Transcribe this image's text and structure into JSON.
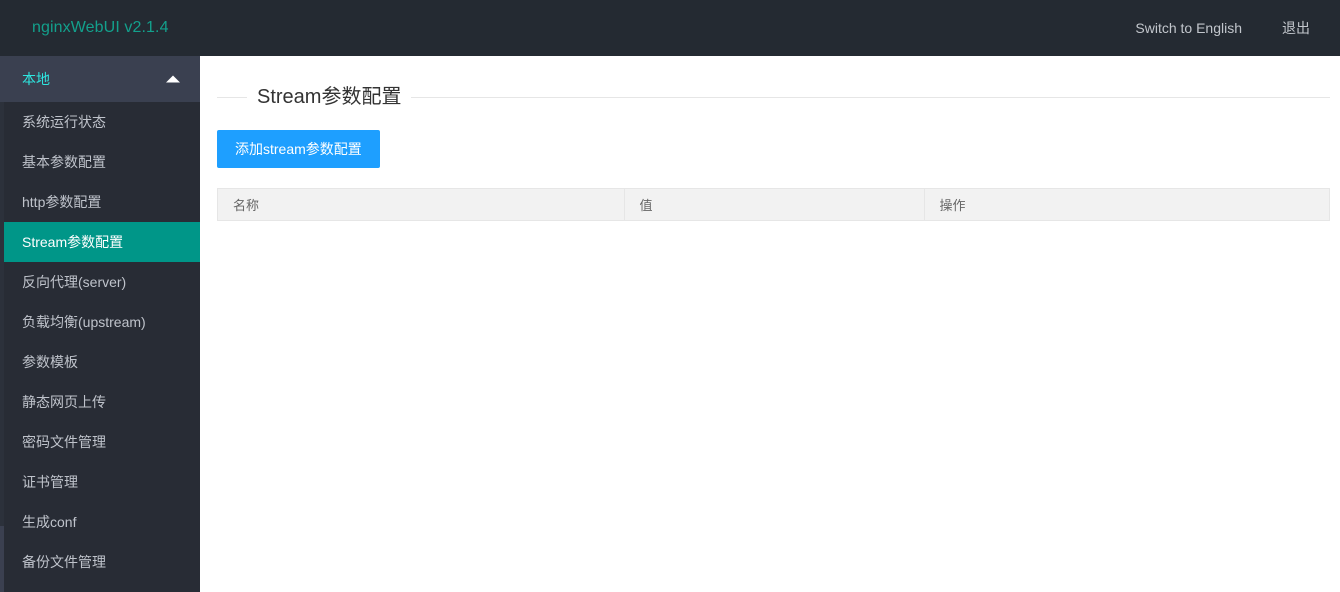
{
  "header": {
    "logo": "nginxWebUI v2.1.4",
    "switch_language": "Switch to English",
    "logout": "退出",
    "bg_color": "#242A32",
    "logo_color": "#13A08C"
  },
  "sidebar": {
    "group": {
      "label": "本地",
      "expanded": true,
      "arrow_icon": "chevron-up-icon",
      "label_color": "#2EE6E0",
      "bg_color": "#3A4050"
    },
    "active_color": "#009688",
    "bg_color": "#282C35",
    "items": [
      {
        "label": "系统运行状态",
        "active": false
      },
      {
        "label": "基本参数配置",
        "active": false
      },
      {
        "label": "http参数配置",
        "active": false
      },
      {
        "label": "Stream参数配置",
        "active": true
      },
      {
        "label": "反向代理(server)",
        "active": false
      },
      {
        "label": "负载均衡(upstream)",
        "active": false
      },
      {
        "label": "参数模板",
        "active": false
      },
      {
        "label": "静态网页上传",
        "active": false
      },
      {
        "label": "密码文件管理",
        "active": false
      },
      {
        "label": "证书管理",
        "active": false
      },
      {
        "label": "生成conf",
        "active": false
      },
      {
        "label": "备份文件管理",
        "active": false
      }
    ]
  },
  "main": {
    "page_title": "Stream参数配置",
    "add_button": "添加stream参数配置",
    "add_button_color": "#1E9FFF",
    "table": {
      "columns": [
        "名称",
        "值",
        "操作"
      ],
      "rows": []
    }
  }
}
